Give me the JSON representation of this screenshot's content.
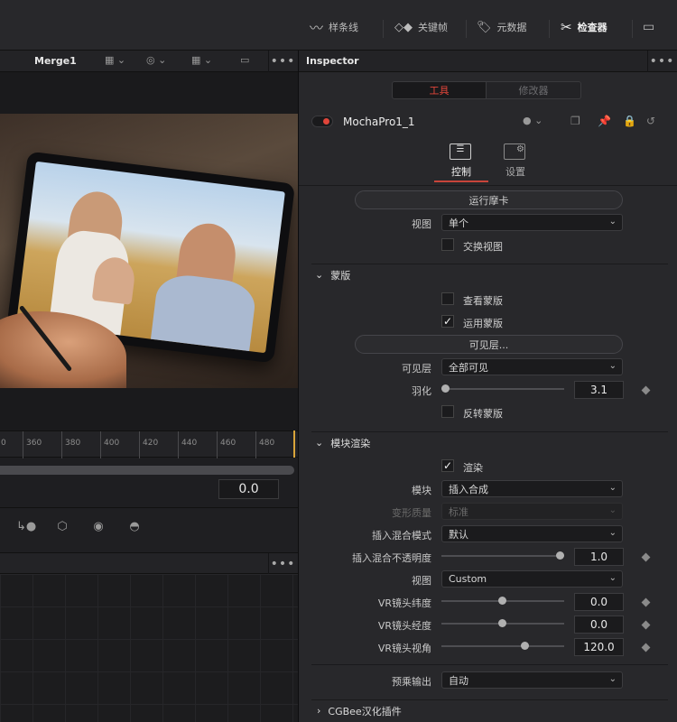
{
  "toolbar": {
    "items": [
      {
        "label": "样条线",
        "icon": "spline-icon"
      },
      {
        "label": "关键帧",
        "icon": "keyframes-icon"
      },
      {
        "label": "元数据",
        "icon": "metadata-icon"
      },
      {
        "label": "检查器",
        "icon": "inspector-icon",
        "active": true
      }
    ]
  },
  "viewer": {
    "title": "Merge1",
    "ruler_ticks": [
      "0",
      "360",
      "380",
      "400",
      "420",
      "440",
      "460",
      "480"
    ],
    "time_value": "0.0"
  },
  "inspector": {
    "title": "Inspector",
    "tab_tools": "工具",
    "tab_modifiers": "修改器",
    "node_name": "MochaPro1_1",
    "subtab_controls": "控制",
    "subtab_settings": "设置",
    "run_mocha": "运行摩卡",
    "view_label": "视图",
    "view_value": "单个",
    "swap_view": "交换视图",
    "matte_section": "蒙版",
    "view_matte": "查看蒙版",
    "apply_matte": "运用蒙版",
    "visible_layers_btn": "可见层...",
    "visible_layers_label": "可见层",
    "visible_layers_value": "全部可见",
    "feather_label": "羽化",
    "feather_value": "3.1",
    "invert_matte": "反转蒙版",
    "module_section": "模块渲染",
    "render_label": "渲染",
    "module_label": "模块",
    "module_value": "插入合成",
    "warp_quality_label": "变形质量",
    "warp_quality_value": "标准",
    "insert_blend_label": "插入混合模式",
    "insert_blend_value": "默认",
    "insert_opacity_label": "插入混合不透明度",
    "insert_opacity_value": "1.0",
    "view2_label": "视图",
    "view2_value": "Custom",
    "vr_lat_label": "VR镜头纬度",
    "vr_lat_value": "0.0",
    "vr_lon_label": "VR镜头经度",
    "vr_lon_value": "0.0",
    "vr_fov_label": "VR镜头视角",
    "vr_fov_value": "120.0",
    "premult_label": "预乘输出",
    "premult_value": "自动",
    "plugin_section": "CGBee汉化插件"
  },
  "colors": {
    "accent_red": "#e0453a",
    "active_tab_underline": "#c8443a"
  }
}
